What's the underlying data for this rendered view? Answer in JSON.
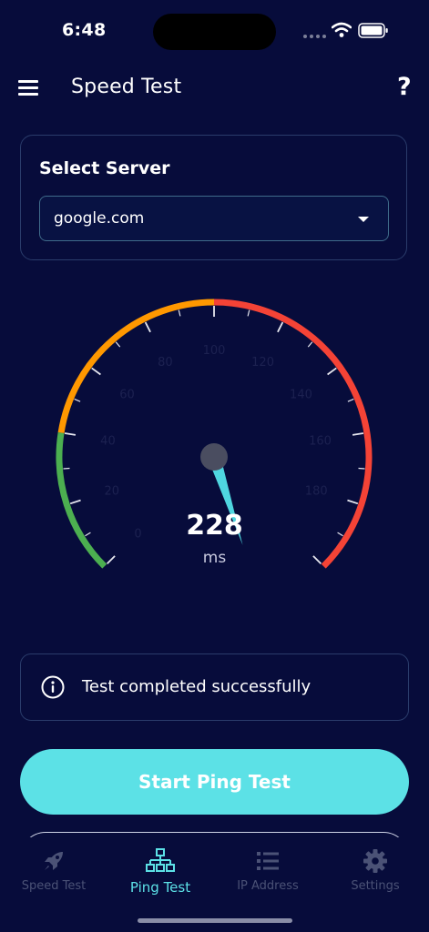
{
  "status_bar": {
    "time": "6:48"
  },
  "app_bar": {
    "title": "Speed Test",
    "help_label": "?"
  },
  "server": {
    "title": "Select Server",
    "selected": "google.com"
  },
  "gauge": {
    "value": "228",
    "unit": "ms",
    "ticks": [
      "0",
      "20",
      "40",
      "60",
      "80",
      "100",
      "120",
      "140",
      "160",
      "180"
    ],
    "min": 0,
    "max": 200,
    "reading": 228,
    "colors": {
      "green": "#4caf50",
      "orange": "#ff9800",
      "red": "#f44336",
      "needle": "#4fd6e0",
      "hub": "#4a4d60"
    }
  },
  "status": {
    "message": "Test completed successfully"
  },
  "start_button": {
    "label": "Start Ping Test"
  },
  "nav": {
    "items": [
      {
        "label": "Speed Test",
        "icon": "rocket-icon"
      },
      {
        "label": "Ping Test",
        "icon": "network-icon"
      },
      {
        "label": "IP Address",
        "icon": "list-icon"
      },
      {
        "label": "Settings",
        "icon": "gear-icon"
      }
    ],
    "active_index": 1,
    "colors": {
      "active": "#5ce1e6",
      "inactive": "#4b5276"
    }
  }
}
